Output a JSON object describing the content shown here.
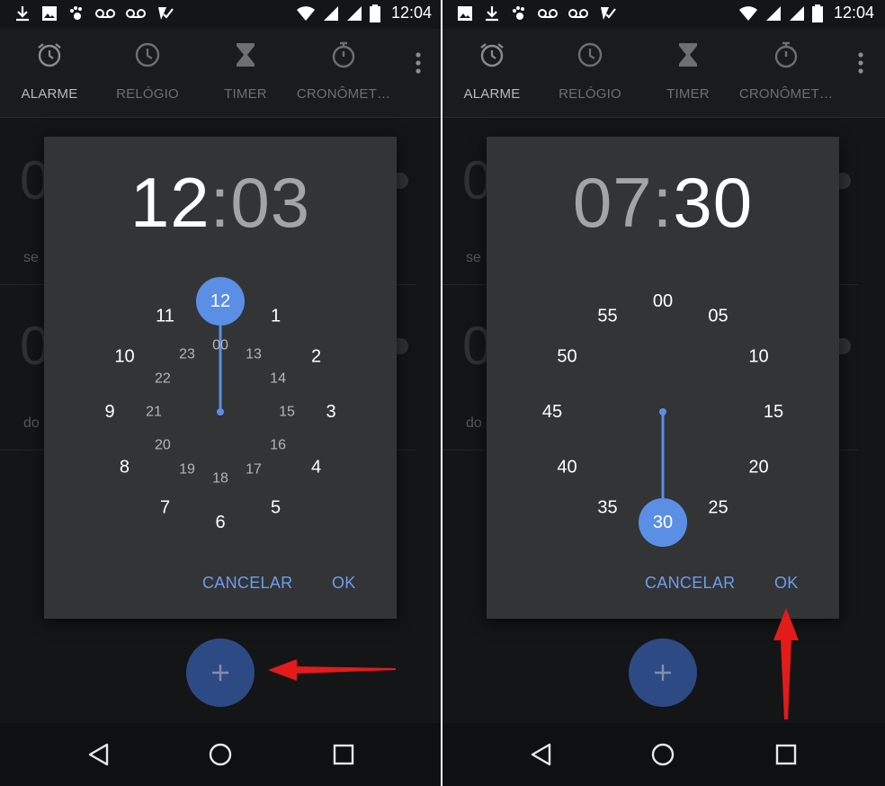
{
  "status_bar": {
    "time": "12:04",
    "left_icons": [
      "download-icon",
      "image-icon",
      "paw-icon",
      "voicemail-icon",
      "voicemail-icon",
      "check-badge-icon"
    ],
    "right_icons": [
      "wifi-icon",
      "signal-icon",
      "signal-icon",
      "battery-icon"
    ]
  },
  "tabs": [
    {
      "label": "ALARME",
      "icon": "alarm-clock-icon",
      "active": true
    },
    {
      "label": "RELÓGIO",
      "icon": "clock-icon",
      "active": false
    },
    {
      "label": "TIMER",
      "icon": "hourglass-icon",
      "active": false
    },
    {
      "label": "CRONÔMET…",
      "icon": "stopwatch-icon",
      "active": false
    }
  ],
  "background_alarms": [
    {
      "time_glyph": "0",
      "label": "se"
    },
    {
      "time_glyph": "0",
      "label": "do"
    }
  ],
  "dialog_hours": {
    "hour": "12",
    "separator": ":",
    "minute": "03",
    "outer_labels": [
      "12",
      "1",
      "2",
      "3",
      "4",
      "5",
      "6",
      "7",
      "8",
      "9",
      "10",
      "11"
    ],
    "inner_labels": [
      "00",
      "13",
      "14",
      "15",
      "16",
      "17",
      "18",
      "19",
      "20",
      "21",
      "22",
      "23"
    ],
    "selected_value": 12,
    "cancel_label": "CANCELAR",
    "ok_label": "OK"
  },
  "dialog_minutes": {
    "hour": "07",
    "separator": ":",
    "minute": "30",
    "outer_labels": [
      "00",
      "05",
      "10",
      "15",
      "20",
      "25",
      "30",
      "35",
      "40",
      "45",
      "50",
      "55"
    ],
    "selected_value": 30,
    "cancel_label": "CANCELAR",
    "ok_label": "OK"
  },
  "fab": {
    "icon": "plus-icon"
  },
  "nav": [
    "back-icon",
    "home-icon",
    "recents-icon"
  ],
  "colors": {
    "accent": "#6c9ef0",
    "selector": "#5b8fe6",
    "dialog": "#333435",
    "background": "#141516",
    "fab": "#2e4a85",
    "annotation_arrow": "#e31b1b"
  }
}
